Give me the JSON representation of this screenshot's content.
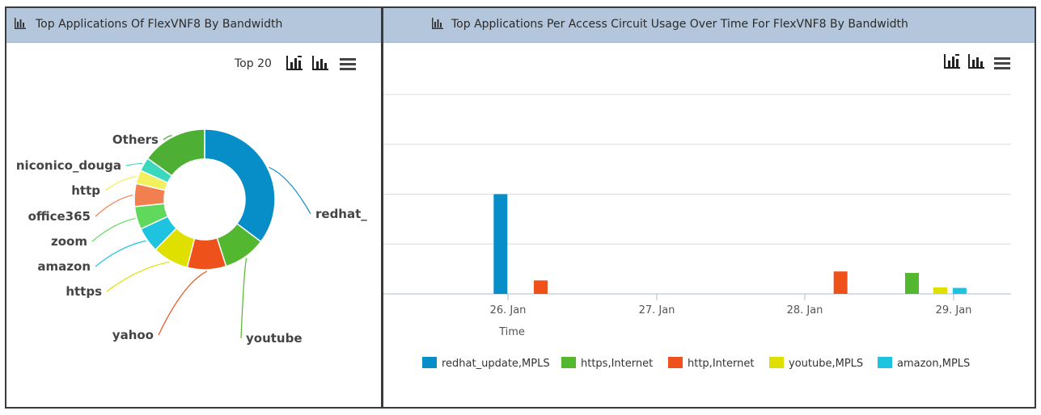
{
  "left_panel": {
    "title": "Top Applications Of FlexVNF8 By Bandwidth",
    "top_n_label": "Top 20"
  },
  "right_panel": {
    "title": "Top Applications Per Access Circuit Usage Over Time For FlexVNF8 By Bandwidth"
  },
  "icons": [
    "bar-chart-icon",
    "column-chart-icon",
    "menu-icon"
  ],
  "chart_data": [
    {
      "type": "pie",
      "donut": true,
      "title": "",
      "labels": [
        "redhat_",
        "youtube",
        "yahoo",
        "https",
        "amazon",
        "zoom",
        "office365",
        "http",
        "niconico_douga",
        "Others"
      ],
      "values": [
        33.5,
        9.3,
        8.5,
        7.9,
        5.5,
        5.0,
        5.0,
        3.0,
        3.0,
        14.3
      ],
      "colors": [
        "#078ec9",
        "#54b730",
        "#ee5119",
        "#dfdf00",
        "#1ec3e0",
        "#5fd85b",
        "#f27f50",
        "#f3f060",
        "#3ad9bd",
        "#4eaf35",
        "#1377c0"
      ],
      "legend": "none"
    },
    {
      "type": "bar",
      "title": "",
      "xlabel": "Time",
      "ylabel": "",
      "x_ticks": [
        "26. Jan",
        "27. Jan",
        "28. Jan",
        "29. Jan"
      ],
      "ylim": [
        0,
        4
      ],
      "grid": true,
      "legend_position": "bottom",
      "series": [
        {
          "name": "redhat_update,MPLS",
          "color": "#078ec9",
          "points": [
            {
              "x": "26. Jan",
              "offset": -0.05,
              "y": 2.0
            }
          ]
        },
        {
          "name": "https,Internet",
          "color": "#54b730",
          "points": [
            {
              "x": "29. Jan",
              "offset": -0.28,
              "y": 0.42
            }
          ]
        },
        {
          "name": "http,Internet",
          "color": "#ee5119",
          "points": [
            {
              "x": "26. Jan",
              "offset": 0.22,
              "y": 0.27
            },
            {
              "x": "28. Jan",
              "offset": 0.24,
              "y": 0.45
            }
          ]
        },
        {
          "name": "youtube,MPLS",
          "color": "#dfdf00",
          "points": [
            {
              "x": "29. Jan",
              "offset": -0.09,
              "y": 0.13
            }
          ]
        },
        {
          "name": "amazon,MPLS",
          "color": "#1ec3e0",
          "points": [
            {
              "x": "29. Jan",
              "offset": 0.04,
              "y": 0.12
            }
          ]
        }
      ]
    }
  ]
}
